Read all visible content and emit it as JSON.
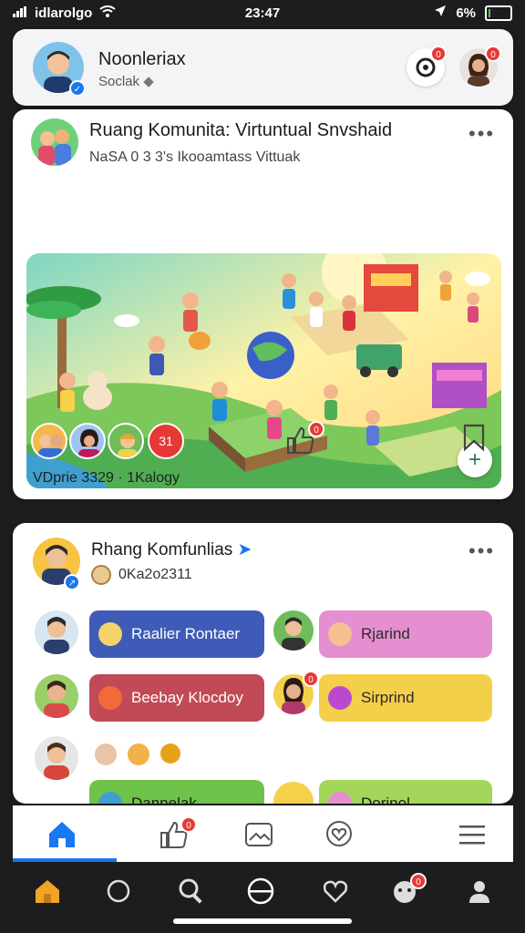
{
  "status_bar": {
    "carrier": "idlarolgo",
    "time": "23:47",
    "battery_text": "6%",
    "battery_level_percent": 6
  },
  "profile_header": {
    "name": "Noonleriax",
    "subtitle": "Soclak",
    "notification_badge": "0",
    "avatar_badge": "0"
  },
  "post_1": {
    "title": "Ruang Komunita: Virtuntual Snvshaid",
    "subtitle": "NaSA 0 3 3's Ikooamtass Vittuak",
    "image_label": "Virtual community playground illustration",
    "footer_meta": "VDprie 3329 · 1Kalogy",
    "extra_reactions_badge": "31",
    "like_badge": "0"
  },
  "post_2": {
    "title": "Rhang Komfunlias",
    "code": "0Ka2o2311",
    "members": [
      {
        "label": "Raalier Rontaer",
        "color": "#3f5bb8",
        "text_color": "#ffffff"
      },
      {
        "label": "Rjarind",
        "color": "#e58fd0",
        "text_color": "#2b2b2b"
      },
      {
        "label": "Beebay Klocdoy",
        "color": "#c24a56",
        "text_color": "#ffffff"
      },
      {
        "label": "Sirprind",
        "color": "#f4cf4a",
        "text_color": "#2b2b2b"
      },
      {
        "label": "Dannelak",
        "color": "#6fc24a",
        "text_color": "#1b1b1b"
      },
      {
        "label": "Dorinol",
        "color": "#a3d65a",
        "text_color": "#1b1b1b"
      }
    ],
    "member_badge": "0"
  },
  "bottom_nav": {
    "like_badge": "0",
    "icons": [
      "home-icon",
      "like-icon",
      "gallery-icon",
      "heart-chat-icon",
      "menu-icon"
    ]
  },
  "system_nav": {
    "badge": "0",
    "icons": [
      "home-icon",
      "circle-icon",
      "search-icon",
      "pill-icon",
      "heart-icon",
      "pet-icon",
      "person-icon"
    ]
  }
}
